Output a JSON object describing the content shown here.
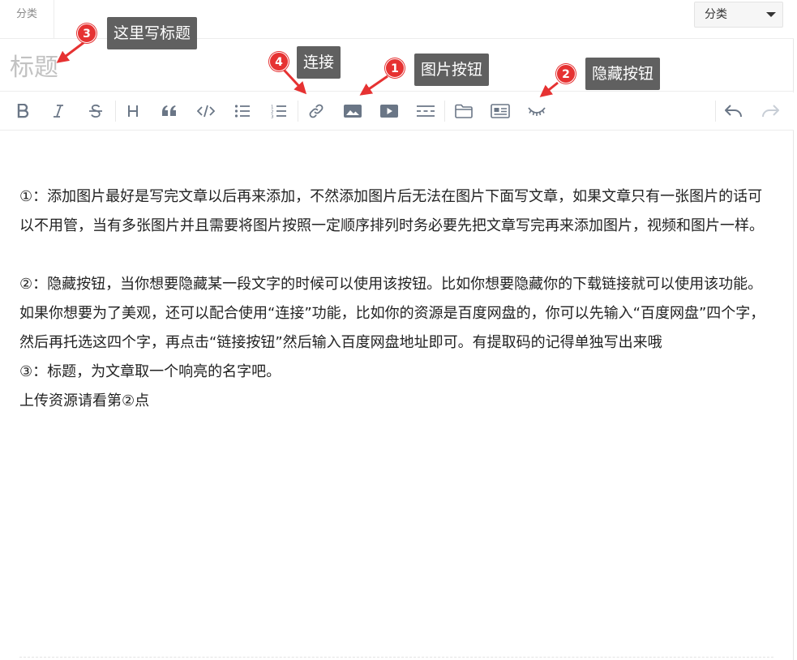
{
  "category": {
    "label": "分类",
    "select_value": "分类"
  },
  "title": {
    "placeholder": "标题"
  },
  "toolbar": {
    "icons": [
      "bold-icon",
      "italic-icon",
      "strikethrough-icon",
      "heading-icon",
      "quote-icon",
      "code-icon",
      "unordered-list-icon",
      "ordered-list-icon",
      "link-icon",
      "image-icon",
      "video-icon",
      "horizontal-rule-icon",
      "folder-icon",
      "card-icon",
      "hide-icon",
      "undo-icon",
      "redo-icon"
    ]
  },
  "content": {
    "paragraph1": "①：添加图片最好是写完文章以后再来添加，不然添加图片后无法在图片下面写文章，如果文章只有一张图片的话可以不用管，当有多张图片并且需要将图片按照一定顺序排列时务必要先把文章写完再来添加图片，视频和图片一样。",
    "paragraph2": "②：隐藏按钮，当你想要隐藏某一段文字的时候可以使用该按钮。比如你想要隐藏你的下载链接就可以使用该功能。如果你想要为了美观，还可以配合使用“连接”功能，比如你的资源是百度网盘的，你可以先输入“百度网盘”四个字，然后再托选这四个字，再点击“链接按钮”然后输入百度网盘地址即可。有提取码的记得单独写出来哦",
    "paragraph3": "③：标题，为文章取一个响亮的名字吧。",
    "paragraph4": "上传资源请看第②点"
  },
  "annotations": [
    {
      "number": "1",
      "text": "图片按钮"
    },
    {
      "number": "2",
      "text": "隐藏按钮"
    },
    {
      "number": "3",
      "text": "这里写标题"
    },
    {
      "number": "4",
      "text": "连接"
    }
  ],
  "colors": {
    "badge": "#e63232",
    "tooltip": "#606060",
    "icon": "#6a7686",
    "icon_disabled": "#c8ced6"
  }
}
